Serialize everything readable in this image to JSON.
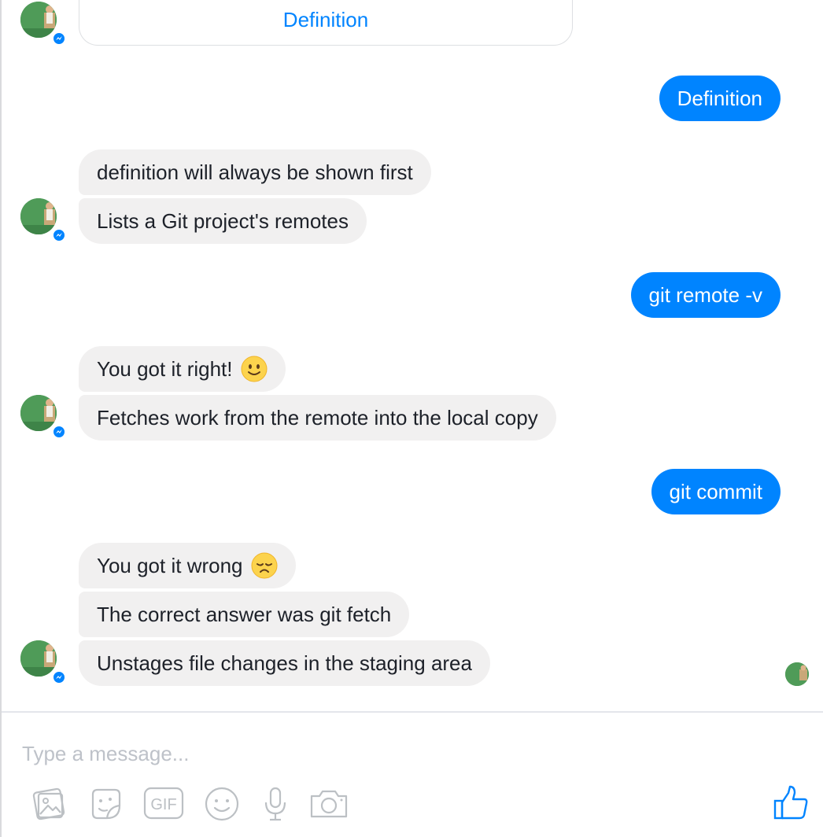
{
  "card": {
    "button_label": "Definition"
  },
  "messages": {
    "m1": "Definition",
    "m2": "definition will always be shown first",
    "m3": "Lists a Git project's remotes",
    "m4": "git remote -v",
    "m5": "You got it right!",
    "m6": "Fetches work from the remote into the local copy",
    "m7": "git commit",
    "m8": "You got it wrong",
    "m9": "The correct answer was git fetch",
    "m10": "Unstages file changes in the staging area"
  },
  "emojis": {
    "m5": "slightly-smiling-face-icon",
    "m8": "disappointed-face-icon"
  },
  "composer": {
    "placeholder": "Type a message..."
  },
  "toolbar": {
    "icons": [
      "photos-icon",
      "stickers-icon",
      "gif-icon",
      "emoji-icon",
      "microphone-icon",
      "camera-icon",
      "thumbs-up-icon"
    ],
    "gif_text": "GIF"
  },
  "colors": {
    "accent": "#0084ff",
    "incoming_bubble": "#f1f0f0",
    "text": "#1d2129",
    "placeholder": "#bec2c9"
  }
}
